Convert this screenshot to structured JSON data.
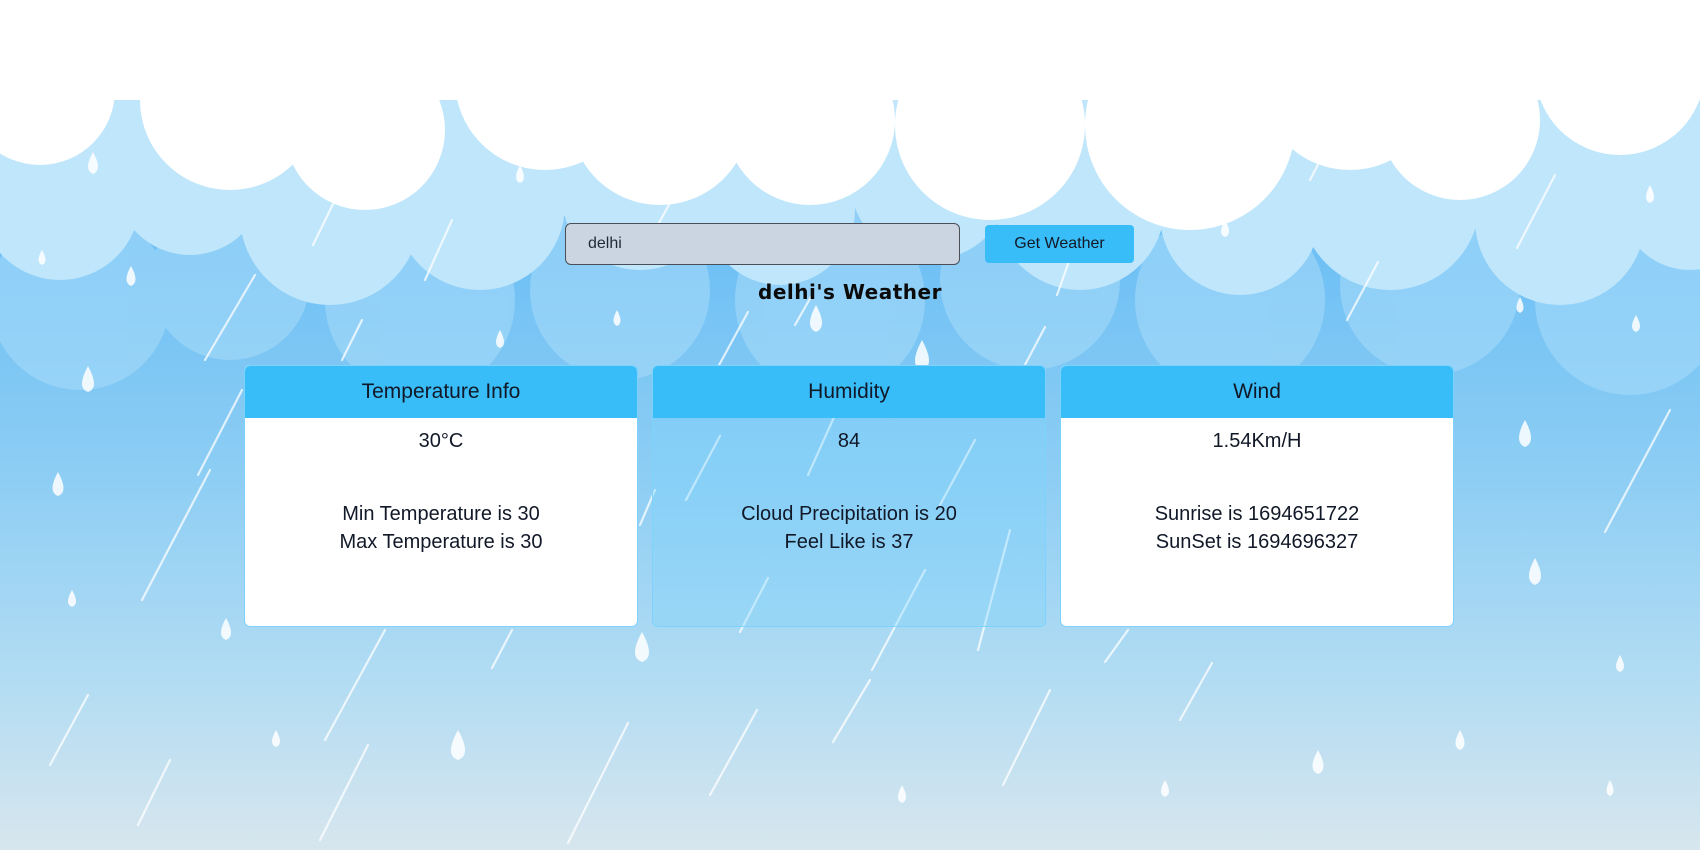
{
  "search": {
    "value": "delhi",
    "button_label": "Get Weather"
  },
  "title": "delhi's Weather",
  "cards": [
    {
      "header": "Temperature Info",
      "main": "30°C",
      "line1": "Min Temperature is 30",
      "line2": "Max Temperature is 30"
    },
    {
      "header": "Humidity",
      "main": "84",
      "line1": "Cloud Precipitation is 20",
      "line2": "Feel Like is 37"
    },
    {
      "header": "Wind",
      "main": "1.54Km/H",
      "line1": "Sunrise is 1694651722",
      "line2": "SunSet is 1694696327"
    }
  ],
  "colors": {
    "accent": "#38bdf8",
    "input_bg": "#cbd5e1",
    "card_bg": "#ffffff"
  }
}
